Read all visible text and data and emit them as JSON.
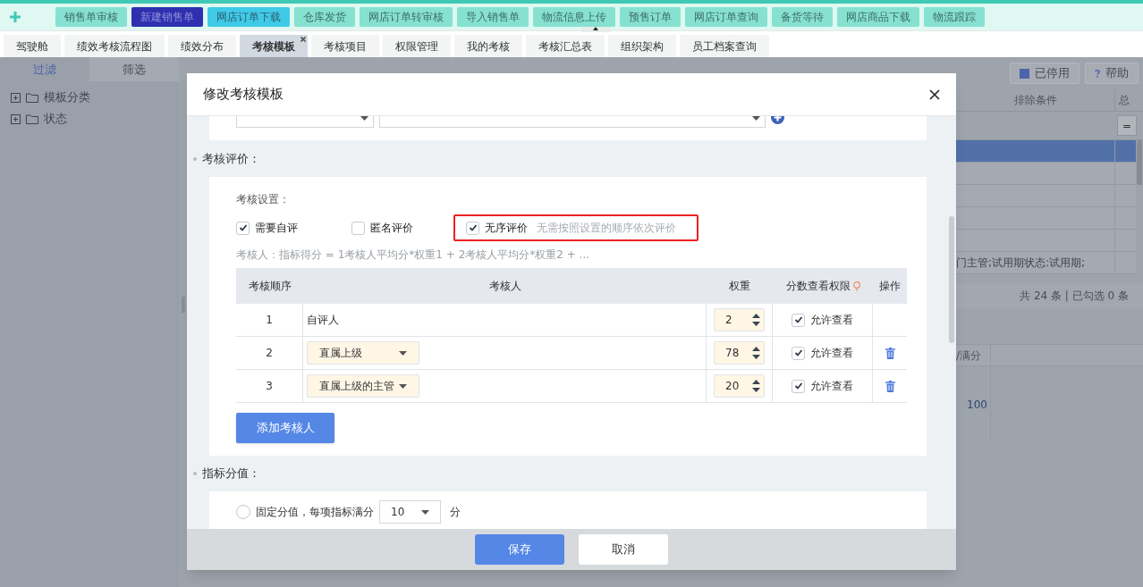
{
  "top_bar": {
    "items": [
      {
        "label": "销售单审核",
        "kind": "normal"
      },
      {
        "label": "新建销售单",
        "kind": "primary"
      },
      {
        "label": "网店订单下载",
        "kind": "info"
      },
      {
        "label": "仓库发货",
        "kind": "normal"
      },
      {
        "label": "网店订单转审核",
        "kind": "normal"
      },
      {
        "label": "导入销售单",
        "kind": "normal"
      },
      {
        "label": "物流信息上传",
        "kind": "normal"
      },
      {
        "label": "预售订单",
        "kind": "normal"
      },
      {
        "label": "网店订单查询",
        "kind": "normal"
      },
      {
        "label": "备货等待",
        "kind": "normal"
      },
      {
        "label": "网店商品下载",
        "kind": "normal"
      },
      {
        "label": "物流跟踪",
        "kind": "normal"
      }
    ]
  },
  "tabs": [
    {
      "label": "驾驶舱",
      "selected": false
    },
    {
      "label": "绩效考核流程图",
      "selected": false
    },
    {
      "label": "绩效分布",
      "selected": false
    },
    {
      "label": "考核模板",
      "selected": true
    },
    {
      "label": "考核项目",
      "selected": false
    },
    {
      "label": "权限管理",
      "selected": false
    },
    {
      "label": "我的考核",
      "selected": false
    },
    {
      "label": "考核汇总表",
      "selected": false
    },
    {
      "label": "组织架构",
      "selected": false
    },
    {
      "label": "员工档案查询",
      "selected": false
    }
  ],
  "sidebar": {
    "tabs": [
      {
        "label": "过滤",
        "selected": true
      },
      {
        "label": "筛选",
        "selected": false
      }
    ],
    "tree": [
      {
        "label": "模板分类",
        "expanded": false
      },
      {
        "label": "状态",
        "expanded": false
      }
    ]
  },
  "toolbar_right": [
    {
      "label": "已停用",
      "kind": "square"
    },
    {
      "label": "帮助",
      "kind": "help"
    }
  ],
  "grid": {
    "columns": [
      "排除条件",
      "总"
    ],
    "filter_button": "=",
    "rows": [
      {
        "selected": true
      },
      {
        "selected": false
      },
      {
        "selected": false
      },
      {
        "selected": false
      },
      {
        "selected": false
      },
      {
        "selected": false,
        "cell": "门主管;试用期状态:试用期;"
      }
    ],
    "footer": "共 24 条 | 已勾选 0 条"
  },
  "detail_grid": {
    "columns": [
      "/满分"
    ],
    "value": "100"
  },
  "dialog": {
    "title": "修改考核模板",
    "evaluation": {
      "heading": "考核评价：",
      "settings_label": "考核设置：",
      "options": [
        {
          "label": "需要自评",
          "checked": true
        },
        {
          "label": "匿名评价",
          "checked": false
        },
        {
          "label": "无序评价",
          "checked": true,
          "highlighted": true,
          "hint": "无需按照设置的顺序依次评价"
        }
      ],
      "formula": "考核人：指标得分 = 1考核人平均分*权重1 + 2考核人平均分*权重2 + ...",
      "table": {
        "columns": [
          "考核顺序",
          "考核人",
          "权重",
          "分数查看权限",
          "操作"
        ],
        "rows": [
          {
            "order": "1",
            "kind": "text",
            "reviewer": "自评人",
            "weight": "2",
            "permission": "允许查看",
            "allowed": true
          },
          {
            "order": "2",
            "kind": "select",
            "reviewer": "直属上级",
            "weight": "78",
            "permission": "允许查看",
            "allowed": true,
            "deletable": true
          },
          {
            "order": "3",
            "kind": "select",
            "reviewer": "直属上级的主管",
            "weight": "20",
            "permission": "允许查看",
            "allowed": true,
            "deletable": true
          }
        ]
      },
      "add_button": "添加考核人"
    },
    "score": {
      "heading": "指标分值：",
      "options": [
        {
          "label": "固定分值，每项指标满分",
          "selected": false,
          "select_value": "10",
          "unit": "分"
        }
      ]
    },
    "buttons": [
      {
        "label": "保存",
        "kind": "primary"
      },
      {
        "label": "取消",
        "kind": "default"
      }
    ]
  }
}
